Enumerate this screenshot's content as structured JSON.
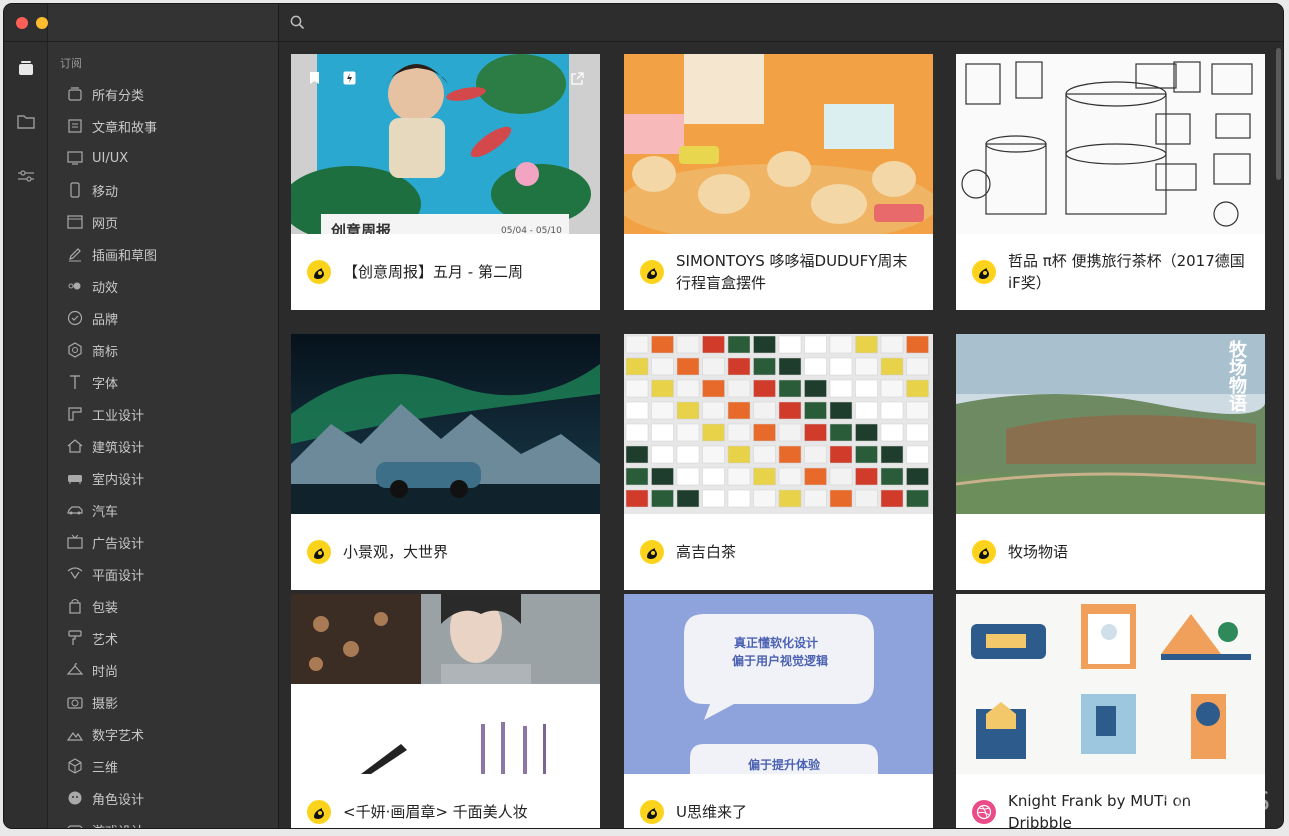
{
  "sidebar": {
    "section_label": "订阅",
    "categories": [
      {
        "label": "所有分类",
        "icon": "stack-icon"
      },
      {
        "label": "文章和故事",
        "icon": "article-icon"
      },
      {
        "label": "UI/UX",
        "icon": "monitor-icon"
      },
      {
        "label": "移动",
        "icon": "phone-icon"
      },
      {
        "label": "网页",
        "icon": "browser-icon"
      },
      {
        "label": "插画和草图",
        "icon": "pencil-icon"
      },
      {
        "label": "动效",
        "icon": "motion-icon"
      },
      {
        "label": "品牌",
        "icon": "check-circle-icon"
      },
      {
        "label": "商标",
        "icon": "hexagon-icon"
      },
      {
        "label": "字体",
        "icon": "type-icon"
      },
      {
        "label": "工业设计",
        "icon": "ruler-icon"
      },
      {
        "label": "建筑设计",
        "icon": "house-icon"
      },
      {
        "label": "室内设计",
        "icon": "sofa-icon"
      },
      {
        "label": "汽车",
        "icon": "car-icon"
      },
      {
        "label": "广告设计",
        "icon": "tv-icon"
      },
      {
        "label": "平面设计",
        "icon": "pen-tool-icon"
      },
      {
        "label": "包装",
        "icon": "bag-icon"
      },
      {
        "label": "艺术",
        "icon": "paint-roller-icon"
      },
      {
        "label": "时尚",
        "icon": "hanger-icon"
      },
      {
        "label": "摄影",
        "icon": "camera-icon"
      },
      {
        "label": "数字艺术",
        "icon": "mountain-icon"
      },
      {
        "label": "三维",
        "icon": "cube-icon"
      },
      {
        "label": "角色设计",
        "icon": "character-icon"
      },
      {
        "label": "游戏设计",
        "icon": "gamepad-icon"
      }
    ]
  },
  "cards": [
    {
      "title": "【创意周报】五月 - 第二周",
      "source_icon": "fire-logo-icon",
      "thumb_text": "创意周报",
      "thumb_date": "05/04 - 05/10"
    },
    {
      "title": "SIMONTOYS 哆哆福DUDUFY周末行程盲盒摆件",
      "source_icon": "fire-logo-icon"
    },
    {
      "title": "哲品 π杯 便携旅行茶杯（2017德国iF奖）",
      "source_icon": "fire-logo-icon"
    },
    {
      "title": "小景观，大世界",
      "source_icon": "fire-logo-icon"
    },
    {
      "title": "高吉白茶",
      "source_icon": "fire-logo-icon"
    },
    {
      "title": "牧场物语",
      "source_icon": "fire-logo-icon",
      "thumb_text": "牧场物语"
    },
    {
      "title": "<千妍·画眉章> 千面美人妆",
      "source_icon": "fire-logo-icon"
    },
    {
      "title": "U思维来了",
      "source_icon": "fire-logo-icon",
      "thumb_text_1": "真正懂软化设计",
      "thumb_text_2": "偏于用户视觉逻辑",
      "thumb_text_3": "偏于提升体验"
    },
    {
      "title": "Knight Frank by MUTI on Dribbble",
      "source_icon": "dribbble-icon"
    }
  ],
  "watermark": "软件SOS",
  "colors": {
    "accent_yellow": "#fcd31c",
    "dribbble_pink": "#ea4c89",
    "window_bg": "#2b2b2b"
  }
}
